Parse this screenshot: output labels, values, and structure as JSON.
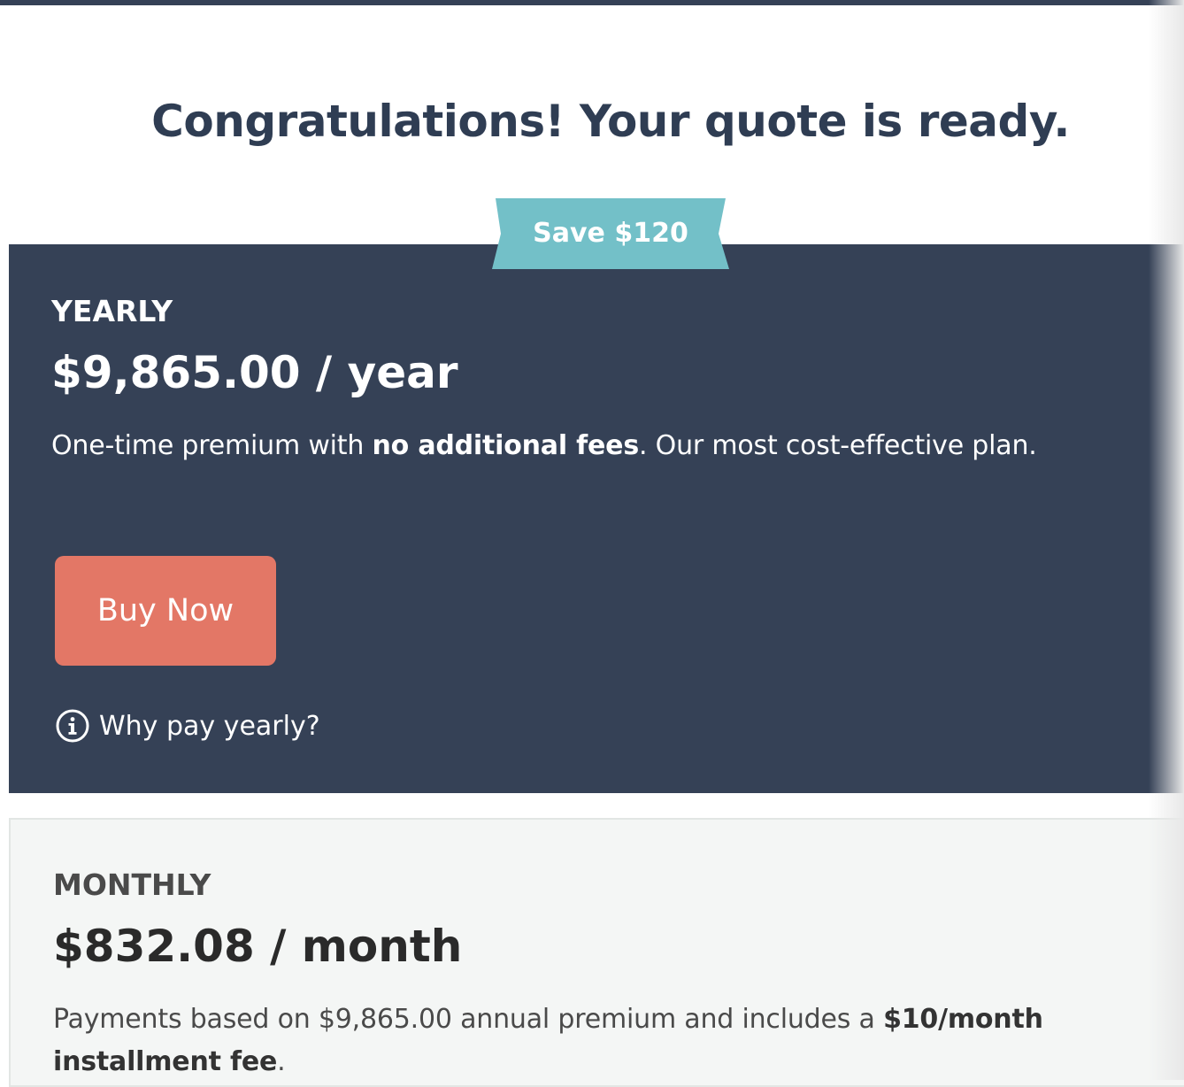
{
  "header": {
    "title": "Congratulations! Your quote is ready."
  },
  "badge": {
    "label": "Save $120",
    "color": "#73c0c8"
  },
  "yearly": {
    "label": "YEARLY",
    "price": "$9,865.00 / year",
    "desc_prefix": "One-time premium with ",
    "desc_bold": "no additional fees",
    "desc_suffix": ". Our most cost-effective plan.",
    "button_label": "Buy Now",
    "why_label": "Why pay yearly?",
    "bg_color": "#354156",
    "button_color": "#e37766"
  },
  "monthly": {
    "label": "MONTHLY",
    "price": "$832.08 / month",
    "desc_prefix": "Payments based on $9,865.00 annual premium and includes a ",
    "desc_bold": "$10/month installment fee",
    "desc_suffix": ".",
    "bg_color": "#f4f6f5"
  },
  "icons": {
    "why_icon": "info-circle-icon"
  }
}
